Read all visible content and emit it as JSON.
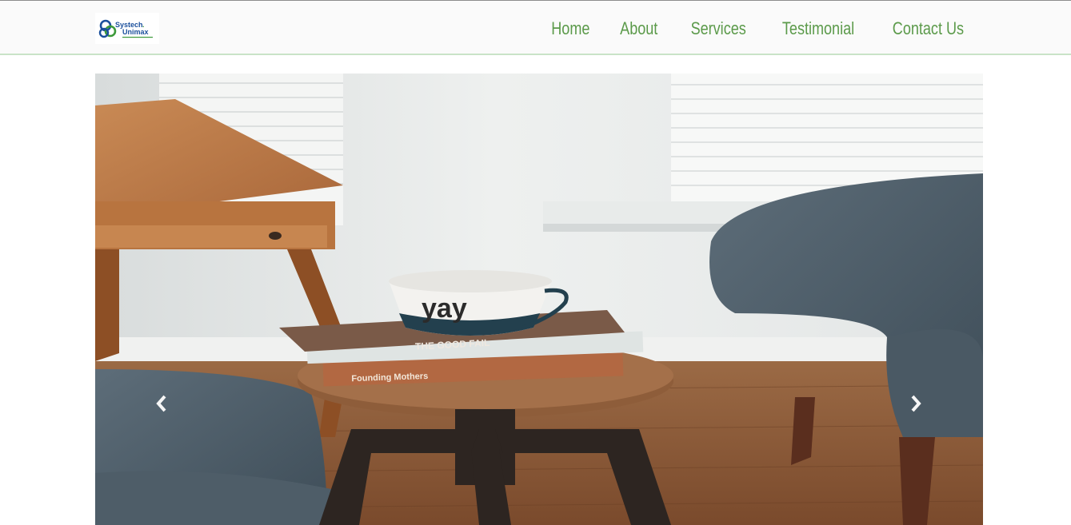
{
  "brand": {
    "logo_line1": "Systech",
    "logo_line2": "Unimax",
    "colors": {
      "blue": "#1a4f9c",
      "green": "#3c9a3a",
      "nav_text": "#5b9a4a"
    }
  },
  "nav": {
    "items": [
      {
        "label": "Home"
      },
      {
        "label": "About"
      },
      {
        "label": "Services"
      },
      {
        "label": "Testimonial"
      },
      {
        "label": "Contact Us"
      }
    ]
  },
  "hero": {
    "book_title_1": "THE GOOD FAIL",
    "book_title_2": "Founding Mothers",
    "cup_text": "yay",
    "icons": {
      "prev": "chevron-left-icon",
      "next": "chevron-right-icon"
    }
  }
}
